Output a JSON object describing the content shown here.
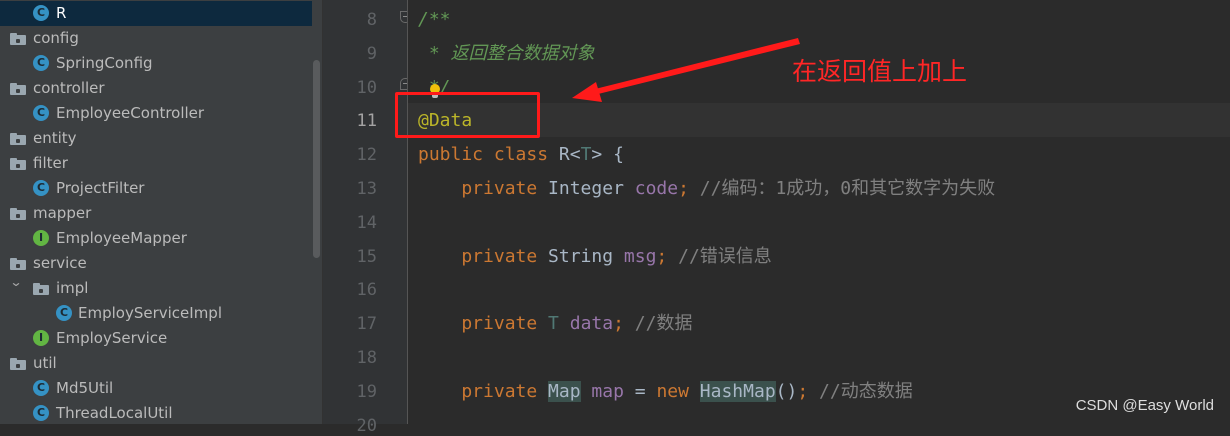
{
  "project_tree": {
    "items": [
      {
        "label": "R",
        "kind": "class",
        "icon": "class-icon",
        "selected": true
      },
      {
        "label": "config",
        "kind": "package",
        "icon": "package-folder-icon"
      },
      {
        "label": "SpringConfig",
        "kind": "class",
        "icon": "class-icon"
      },
      {
        "label": "controller",
        "kind": "package",
        "icon": "package-folder-icon"
      },
      {
        "label": "EmployeeController",
        "kind": "class",
        "icon": "class-icon"
      },
      {
        "label": "entity",
        "kind": "package",
        "icon": "package-folder-icon"
      },
      {
        "label": "filter",
        "kind": "package",
        "icon": "package-folder-icon"
      },
      {
        "label": "ProjectFilter",
        "kind": "class",
        "icon": "class-icon"
      },
      {
        "label": "mapper",
        "kind": "package",
        "icon": "package-folder-icon"
      },
      {
        "label": "EmployeeMapper",
        "kind": "interface",
        "icon": "interface-icon"
      },
      {
        "label": "service",
        "kind": "package",
        "icon": "package-folder-icon"
      },
      {
        "label": "impl",
        "kind": "package",
        "icon": "package-folder-icon",
        "expanded": true
      },
      {
        "label": "EmployServiceImpl",
        "kind": "class",
        "icon": "class-icon"
      },
      {
        "label": "EmployService",
        "kind": "interface",
        "icon": "interface-icon"
      },
      {
        "label": "util",
        "kind": "package",
        "icon": "package-folder-icon"
      },
      {
        "label": "Md5Util",
        "kind": "class",
        "icon": "class-icon"
      },
      {
        "label": "ThreadLocalUtil",
        "kind": "class",
        "icon": "class-icon"
      }
    ],
    "class_letter": "C",
    "interface_letter": "I"
  },
  "editor": {
    "line_numbers": [
      "8",
      "9",
      "10",
      "11",
      "12",
      "13",
      "14",
      "15",
      "16",
      "17",
      "18",
      "19",
      "20"
    ],
    "current_line": "11",
    "lines": [
      {
        "tokens": [
          {
            "t": "/**",
            "c": "doc"
          }
        ]
      },
      {
        "tokens": [
          {
            "t": " * 返回整合数据对象",
            "c": "doc"
          }
        ]
      },
      {
        "tokens": [
          {
            "t": " */",
            "c": "doc"
          }
        ]
      },
      {
        "tokens": [
          {
            "t": "@Data",
            "c": "annot"
          }
        ]
      },
      {
        "tokens": [
          {
            "t": "public ",
            "c": "kw"
          },
          {
            "t": "class ",
            "c": "kw"
          },
          {
            "t": "R<",
            "c": "plain"
          },
          {
            "t": "T",
            "c": "tparam"
          },
          {
            "t": "> {",
            "c": "plain"
          }
        ]
      },
      {
        "tokens": [
          {
            "t": "    private ",
            "c": "kw"
          },
          {
            "t": "Integer ",
            "c": "plain"
          },
          {
            "t": "code",
            "c": "field"
          },
          {
            "t": "; ",
            "c": "kw"
          },
          {
            "t": "//编码：1成功，0和其它数字为失败",
            "c": "comment"
          }
        ]
      },
      {
        "tokens": []
      },
      {
        "tokens": [
          {
            "t": "    private ",
            "c": "kw"
          },
          {
            "t": "String ",
            "c": "plain"
          },
          {
            "t": "msg",
            "c": "field"
          },
          {
            "t": "; ",
            "c": "kw"
          },
          {
            "t": "//错误信息",
            "c": "comment"
          }
        ]
      },
      {
        "tokens": []
      },
      {
        "tokens": [
          {
            "t": "    private ",
            "c": "kw"
          },
          {
            "t": "T ",
            "c": "tparam"
          },
          {
            "t": "data",
            "c": "field"
          },
          {
            "t": "; ",
            "c": "kw"
          },
          {
            "t": "//数据",
            "c": "comment"
          }
        ]
      },
      {
        "tokens": []
      },
      {
        "tokens": [
          {
            "t": "    private ",
            "c": "kw"
          },
          {
            "t": "Map",
            "c": "plain",
            "hl": true
          },
          {
            "t": " ",
            "c": "plain"
          },
          {
            "t": "map",
            "c": "field"
          },
          {
            "t": " = ",
            "c": "plain"
          },
          {
            "t": "new ",
            "c": "kw"
          },
          {
            "t": "HashMap",
            "c": "plain",
            "hl": true
          },
          {
            "t": "()",
            "c": "plain"
          },
          {
            "t": "; ",
            "c": "kw"
          },
          {
            "t": "//动态数据",
            "c": "comment"
          }
        ]
      },
      {
        "tokens": []
      }
    ]
  },
  "annotation": {
    "text": "在返回值上加上",
    "color": "#ff1a1a"
  },
  "watermark": "CSDN @Easy World",
  "colors": {
    "keyword": "#cc7832",
    "annotation": "#bbb529",
    "field": "#9876aa",
    "comment": "#808080",
    "doc_comment": "#629755",
    "type_param": "#507874"
  }
}
